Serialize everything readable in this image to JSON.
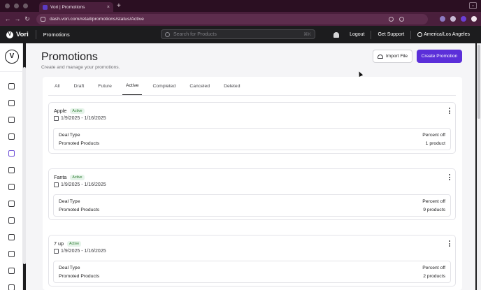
{
  "browser": {
    "tab_title": "Vori | Promotions",
    "tab_close": "×",
    "new_tab": "+",
    "url": "dash.vori.com/retail/promotions/status/Active",
    "nav": {
      "back": "←",
      "forward": "→",
      "reload": "↻"
    },
    "extension_colors": [
      "#8c7ac2",
      "#c7b9d4",
      "#6b3fd6",
      "#f1e6ee"
    ]
  },
  "header": {
    "brand": "Vori",
    "logo_letter": "V",
    "section": "Promotions",
    "search_placeholder": "Search for Products",
    "search_shortcut": "⌘K",
    "logout": "Logout",
    "support": "Get Support",
    "timezone": "America/Los Angeles"
  },
  "sidebar": {
    "logo_letter": "V",
    "items": [
      {
        "icon": "home-icon",
        "active": false
      },
      {
        "icon": "chart-bars-icon",
        "active": false
      },
      {
        "icon": "report-icon",
        "active": false
      },
      {
        "icon": "cube-icon",
        "active": false
      },
      {
        "icon": "tag-icon",
        "active": true
      },
      {
        "icon": "gift-icon",
        "active": false
      },
      {
        "icon": "megaphone-icon",
        "active": false
      },
      {
        "icon": "truck-icon",
        "active": false
      },
      {
        "icon": "percent-icon",
        "active": false
      },
      {
        "icon": "grid-icon",
        "active": false
      },
      {
        "icon": "scan-icon",
        "active": false
      },
      {
        "icon": "users-icon",
        "active": false
      },
      {
        "icon": "settings-sliders-icon",
        "active": false
      }
    ]
  },
  "page": {
    "title": "Promotions",
    "subtitle": "Create and manage your promotions.",
    "import_button": "Import File",
    "create_button": "Create Promotion",
    "accent_color": "#5b2fd9"
  },
  "tabs": [
    "All",
    "Draft",
    "Future",
    "Active",
    "Completed",
    "Canceled",
    "Deleted"
  ],
  "active_tab": "Active",
  "promotions": [
    {
      "name": "Apple",
      "status": "Active",
      "dates": "1/9/2025 - 1/16/2025",
      "deal_type_label": "Deal Type",
      "deal_type": "Percent off",
      "products_label": "Promoted Products",
      "products": "1 product"
    },
    {
      "name": "Fanta",
      "status": "Active",
      "dates": "1/9/2025 - 1/16/2025",
      "deal_type_label": "Deal Type",
      "deal_type": "Percent off",
      "products_label": "Promoted Products",
      "products": "9 products"
    },
    {
      "name": "7 up",
      "status": "Active",
      "dates": "1/9/2025 - 1/16/2025",
      "deal_type_label": "Deal Type",
      "deal_type": "Percent off",
      "products_label": "Promoted Products",
      "products": "2 products"
    }
  ]
}
